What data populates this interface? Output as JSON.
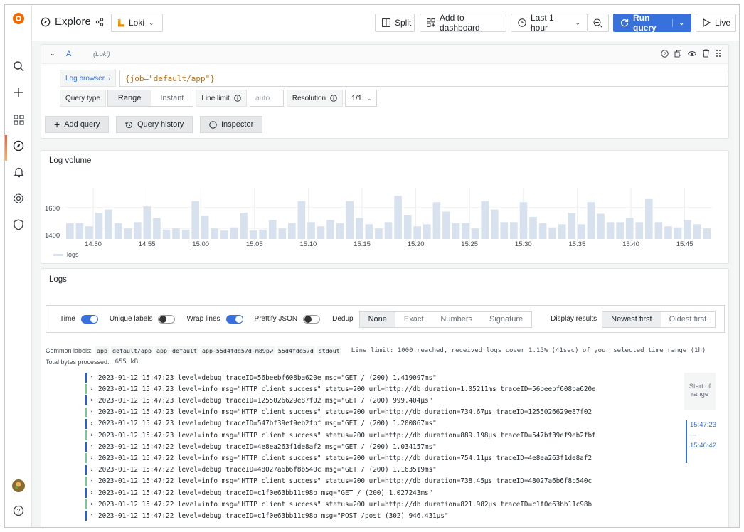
{
  "header": {
    "title": "Explore",
    "datasource": "Loki",
    "split": "Split",
    "add_to_dashboard": "Add to dashboard",
    "time_range": "Last 1 hour",
    "run_query": "Run query",
    "live": "Live"
  },
  "query": {
    "ref": "A",
    "datasource": "(Loki)",
    "log_browser": "Log browser",
    "expression": "{job=\"default/app\"}",
    "query_type_label": "Query type",
    "query_types": [
      "Range",
      "Instant"
    ],
    "line_limit_label": "Line limit",
    "line_limit_placeholder": "auto",
    "resolution_label": "Resolution",
    "resolution_value": "1/1",
    "add_query": "Add query",
    "query_history": "Query history",
    "inspector": "Inspector"
  },
  "log_volume": {
    "title": "Log volume",
    "legend": "logs",
    "y_ticks": [
      "1600",
      "1400"
    ],
    "x_ticks": [
      "14:50",
      "14:55",
      "15:00",
      "15:05",
      "15:10",
      "15:15",
      "15:20",
      "15:25",
      "15:30",
      "15:35",
      "15:40",
      "15:45"
    ]
  },
  "chart_data": {
    "type": "bar",
    "title": "Log volume",
    "series": [
      {
        "name": "logs",
        "values": [
          1450,
          1450,
          1420,
          1550,
          1580,
          1450,
          1400,
          1460,
          1610,
          1500,
          1390,
          1400,
          1390,
          1660,
          1520,
          1400,
          1380,
          1410,
          1550,
          1380,
          1390,
          1480,
          1400,
          1450,
          1660,
          1460,
          1420,
          1480,
          1450,
          1660,
          1500,
          1440,
          1400,
          1460,
          1710,
          1530,
          1420,
          1440,
          1650,
          1560,
          1450,
          1450,
          1400,
          1660,
          1580,
          1460,
          1460,
          1650,
          1510,
          1450,
          1410,
          1440,
          1550,
          1440,
          1650,
          1540,
          1460,
          1460,
          1500,
          1460,
          1680,
          1460,
          1420,
          1410,
          1480,
          1440,
          1400
        ]
      }
    ],
    "ylim": [
      1300,
      1800
    ],
    "y_ticks": [
      1400,
      1600
    ],
    "legend": "bottom-left"
  },
  "logs": {
    "title": "Logs",
    "time_label": "Time",
    "unique_labels": "Unique labels",
    "wrap_lines": "Wrap lines",
    "prettify_json": "Prettify JSON",
    "dedup_label": "Dedup",
    "dedup_options": [
      "None",
      "Exact",
      "Numbers",
      "Signature"
    ],
    "display_results": "Display results",
    "order_options": [
      "Newest first",
      "Oldest first"
    ],
    "common_labels_label": "Common labels:",
    "common_labels": [
      "app",
      "default/app",
      "app",
      "default",
      "app-55d4fdd57d-m89pw",
      "55d4fdd57d",
      "stdout"
    ],
    "line_limit_note": "Line limit: 1000 reached, received logs cover 1.15% (41sec) of your selected time range (1h)",
    "total_bytes_label": "Total bytes processed:",
    "total_bytes": "655 kB",
    "range_start": "Start of range",
    "range_t1": "15:47:23",
    "range_dash": "—",
    "range_t2": "15:46:42",
    "lines": [
      {
        "level": "debug",
        "text": "2023-01-12 15:47:23 level=debug traceID=56beebf608ba620e msg=\"GET / (200) 1.419097ms\""
      },
      {
        "level": "info",
        "text": "2023-01-12 15:47:23 level=info msg=\"HTTP client success\" status=200 url=http://db duration=1.05211ms traceID=56beebf608ba620e"
      },
      {
        "level": "debug",
        "text": "2023-01-12 15:47:23 level=debug traceID=1255026629e87f02 msg=\"GET / (200) 999.404µs\""
      },
      {
        "level": "info",
        "text": "2023-01-12 15:47:23 level=info msg=\"HTTP client success\" status=200 url=http://db duration=734.67µs traceID=1255026629e87f02"
      },
      {
        "level": "debug",
        "text": "2023-01-12 15:47:23 level=debug traceID=547bf39ef9eb2fbf msg=\"GET / (200) 1.200867ms\""
      },
      {
        "level": "info",
        "text": "2023-01-12 15:47:23 level=info msg=\"HTTP client success\" status=200 url=http://db duration=889.198µs traceID=547bf39ef9eb2fbf"
      },
      {
        "level": "debug",
        "text": "2023-01-12 15:47:22 level=debug traceID=4e8ea263f1de8af2 msg=\"GET / (200) 1.034157ms\""
      },
      {
        "level": "info",
        "text": "2023-01-12 15:47:22 level=info msg=\"HTTP client success\" status=200 url=http://db duration=754.11µs traceID=4e8ea263f1de8af2"
      },
      {
        "level": "debug",
        "text": "2023-01-12 15:47:22 level=debug traceID=48027a6b6f8b540c msg=\"GET / (200) 1.163519ms\""
      },
      {
        "level": "info",
        "text": "2023-01-12 15:47:22 level=info msg=\"HTTP client success\" status=200 url=http://db duration=738.45µs traceID=48027a6b6f8b540c"
      },
      {
        "level": "debug",
        "text": "2023-01-12 15:47:22 level=debug traceID=c1f0e63bb11c98b msg=\"GET / (200) 1.027243ms\""
      },
      {
        "level": "info",
        "text": "2023-01-12 15:47:22 level=info msg=\"HTTP client success\" status=200 url=http://db duration=821.982µs traceID=c1f0e63bb11c98b"
      },
      {
        "level": "debug",
        "text": "2023-01-12 15:47:22 level=debug traceID=c1f0e63bb11c98b msg=\"POST /post (302) 946.431µs\""
      }
    ]
  },
  "colors": {
    "accent": "#3871dc",
    "debug": "#1f62e0",
    "info": "#6ccf8e",
    "bar": "#d8e1ee"
  }
}
